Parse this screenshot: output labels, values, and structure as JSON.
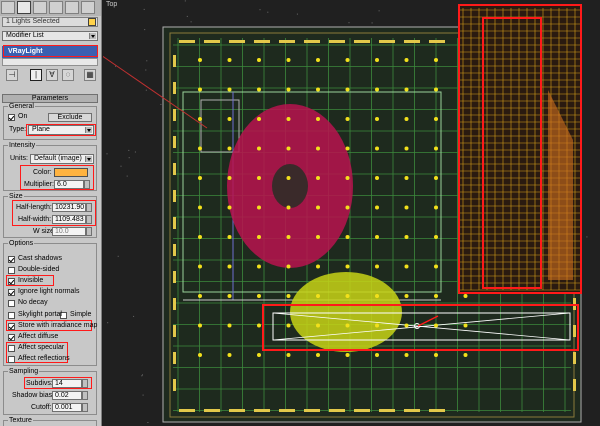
{
  "selection": {
    "label": "1 Lights Selected"
  },
  "modifier_list": {
    "label": "Modifier List"
  },
  "stack": {
    "item": "VRayLight"
  },
  "rollout": {
    "title": "Parameters"
  },
  "general": {
    "title": "General",
    "on_label": "On",
    "on_checked": true,
    "exclude_label": "Exclude",
    "type_label": "Type:",
    "type_value": "Plane"
  },
  "intensity": {
    "title": "Intensity",
    "units_label": "Units:",
    "units_value": "Default (image)",
    "color_label": "Color:",
    "color_hex": "#ffb340",
    "multiplier_label": "Multiplier:",
    "multiplier_value": "6.0"
  },
  "size": {
    "title": "Size",
    "half_length_label": "Half-length:",
    "half_length_value": "10231.90",
    "half_width_label": "Half-width:",
    "half_width_value": "1109.483",
    "w_size_label": "W size",
    "w_size_value": "10.0"
  },
  "options": {
    "title": "Options",
    "items": [
      {
        "label": "Cast shadows",
        "checked": true
      },
      {
        "label": "Double-sided",
        "checked": false
      },
      {
        "label": "Invisible",
        "checked": true
      },
      {
        "label": "Ignore light normals",
        "checked": true
      },
      {
        "label": "No decay",
        "checked": false
      },
      {
        "label": "Skylight portal",
        "checked": false
      },
      {
        "label": "Store with irradiance map",
        "checked": true
      },
      {
        "label": "Affect diffuse",
        "checked": true
      },
      {
        "label": "Affect specular",
        "checked": false
      },
      {
        "label": "Affect reflections",
        "checked": false
      }
    ],
    "simple_label": "Simple"
  },
  "sampling": {
    "title": "Sampling",
    "subdivs_label": "Subdivs:",
    "subdivs_value": "14",
    "shadow_bias_label": "Shadow bias:",
    "shadow_bias_value": "0.02",
    "cutoff_label": "Cutoff:",
    "cutoff_value": "0.001"
  },
  "texture": {
    "title": "Texture"
  },
  "viewport": {
    "label": "Top"
  },
  "colors": {
    "highlight": "#ff1a1a",
    "selection_blue": "#3b5fb0",
    "light_yellow": "#f2e01c",
    "plan_green": "#3d8a3d"
  }
}
